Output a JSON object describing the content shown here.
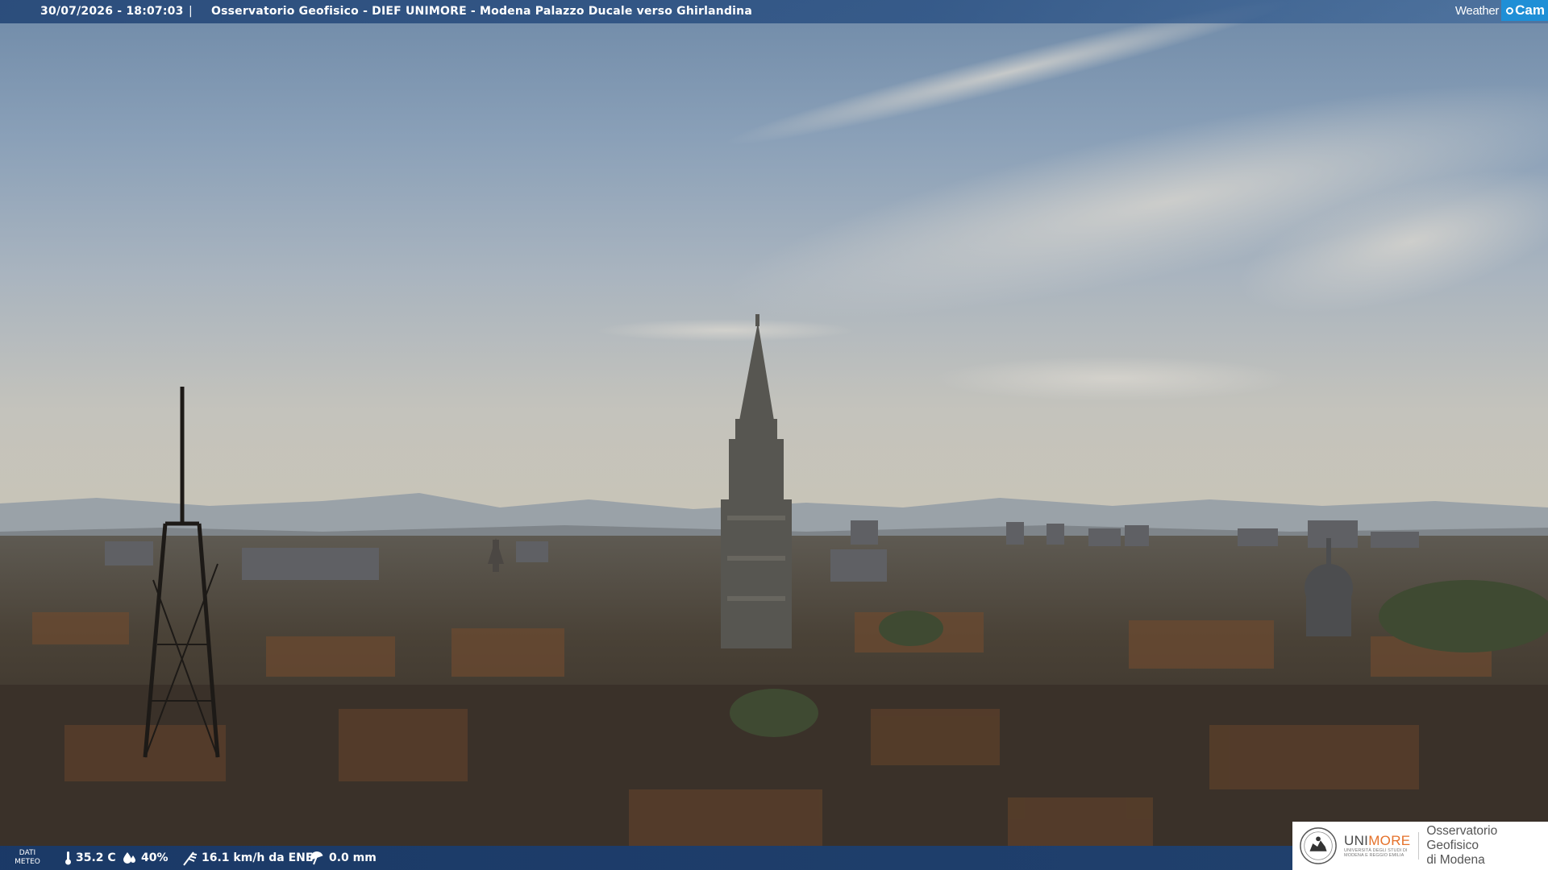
{
  "header": {
    "timestamp": "30/07/2026 - 18:07:03",
    "separator": "|",
    "camera_title": "Osservatorio Geofisico - DIEF UNIMORE - Modena Palazzo Ducale verso Ghirlandina"
  },
  "brand": {
    "weather_text": "Weather",
    "cam_text": "Cam",
    "accent_color": "#1f8fd6"
  },
  "meteo": {
    "label_line1": "DATI",
    "label_line2": "METEO",
    "temperature": "35.2 C",
    "temperature_icon": "thermometer-icon",
    "humidity": "40%",
    "humidity_icon": "humidity-drop-icon",
    "wind": "16.1 km/h da ENE",
    "wind_icon": "wind-icon",
    "rain": "0.0 mm",
    "rain_icon": "umbrella-icon"
  },
  "logo": {
    "uni_part1": "UNI",
    "uni_part2": "MORE",
    "uni_sub1": "UNIVERSITÀ DEGLI STUDI DI",
    "uni_sub2": "MODENA E REGGIO EMILIA",
    "obs_line1": "Osservatorio Geofisico",
    "obs_line2": "di Modena",
    "brand_orange": "#e5712a"
  }
}
